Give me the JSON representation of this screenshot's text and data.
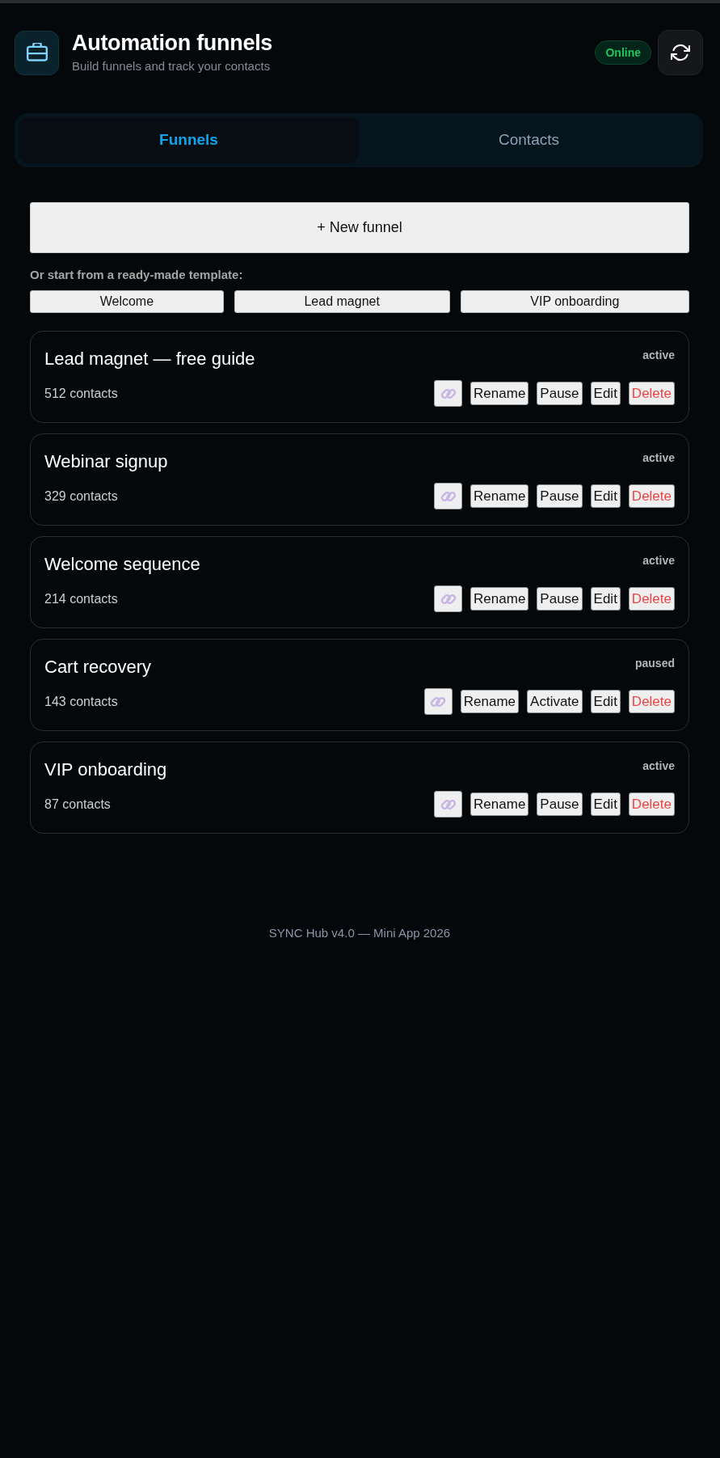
{
  "header": {
    "title": "Automation funnels",
    "subtitle": "Build funnels and track your contacts",
    "status": {
      "label": "Online",
      "kind": "online"
    }
  },
  "tabs": [
    {
      "label": "Funnels",
      "selected": true
    },
    {
      "label": "Contacts",
      "selected": false
    }
  ],
  "new_funnel_button": "+ New funnel",
  "templates": {
    "label": "Or start from a ready-made template:",
    "items": [
      "Welcome",
      "Lead magnet",
      "VIP onboarding"
    ]
  },
  "funnels": [
    {
      "name": "Lead magnet — free guide",
      "status": "active",
      "contacts": "512 contacts",
      "actions": [
        {
          "label": "Rename",
          "kind": "rename"
        },
        {
          "label": "Pause",
          "kind": "pause"
        },
        {
          "label": "Edit",
          "kind": "edit"
        },
        {
          "label": "Delete",
          "kind": "delete"
        }
      ]
    },
    {
      "name": "Webinar signup",
      "status": "active",
      "contacts": "329 contacts",
      "actions": [
        {
          "label": "Rename",
          "kind": "rename"
        },
        {
          "label": "Pause",
          "kind": "pause"
        },
        {
          "label": "Edit",
          "kind": "edit"
        },
        {
          "label": "Delete",
          "kind": "delete"
        }
      ]
    },
    {
      "name": "Welcome sequence",
      "status": "active",
      "contacts": "214 contacts",
      "actions": [
        {
          "label": "Rename",
          "kind": "rename"
        },
        {
          "label": "Pause",
          "kind": "pause"
        },
        {
          "label": "Edit",
          "kind": "edit"
        },
        {
          "label": "Delete",
          "kind": "delete"
        }
      ]
    },
    {
      "name": "Cart recovery",
      "status": "paused",
      "contacts": "143 contacts",
      "actions": [
        {
          "label": "Rename",
          "kind": "rename"
        },
        {
          "label": "Activate",
          "kind": "activate"
        },
        {
          "label": "Edit",
          "kind": "edit"
        },
        {
          "label": "Delete",
          "kind": "delete"
        }
      ]
    },
    {
      "name": "VIP onboarding",
      "status": "active",
      "contacts": "87 contacts",
      "actions": [
        {
          "label": "Rename",
          "kind": "rename"
        },
        {
          "label": "Pause",
          "kind": "pause"
        },
        {
          "label": "Edit",
          "kind": "edit"
        },
        {
          "label": "Delete",
          "kind": "delete"
        }
      ]
    }
  ],
  "footer": "SYNC Hub v4.0 — Mini App 2026"
}
